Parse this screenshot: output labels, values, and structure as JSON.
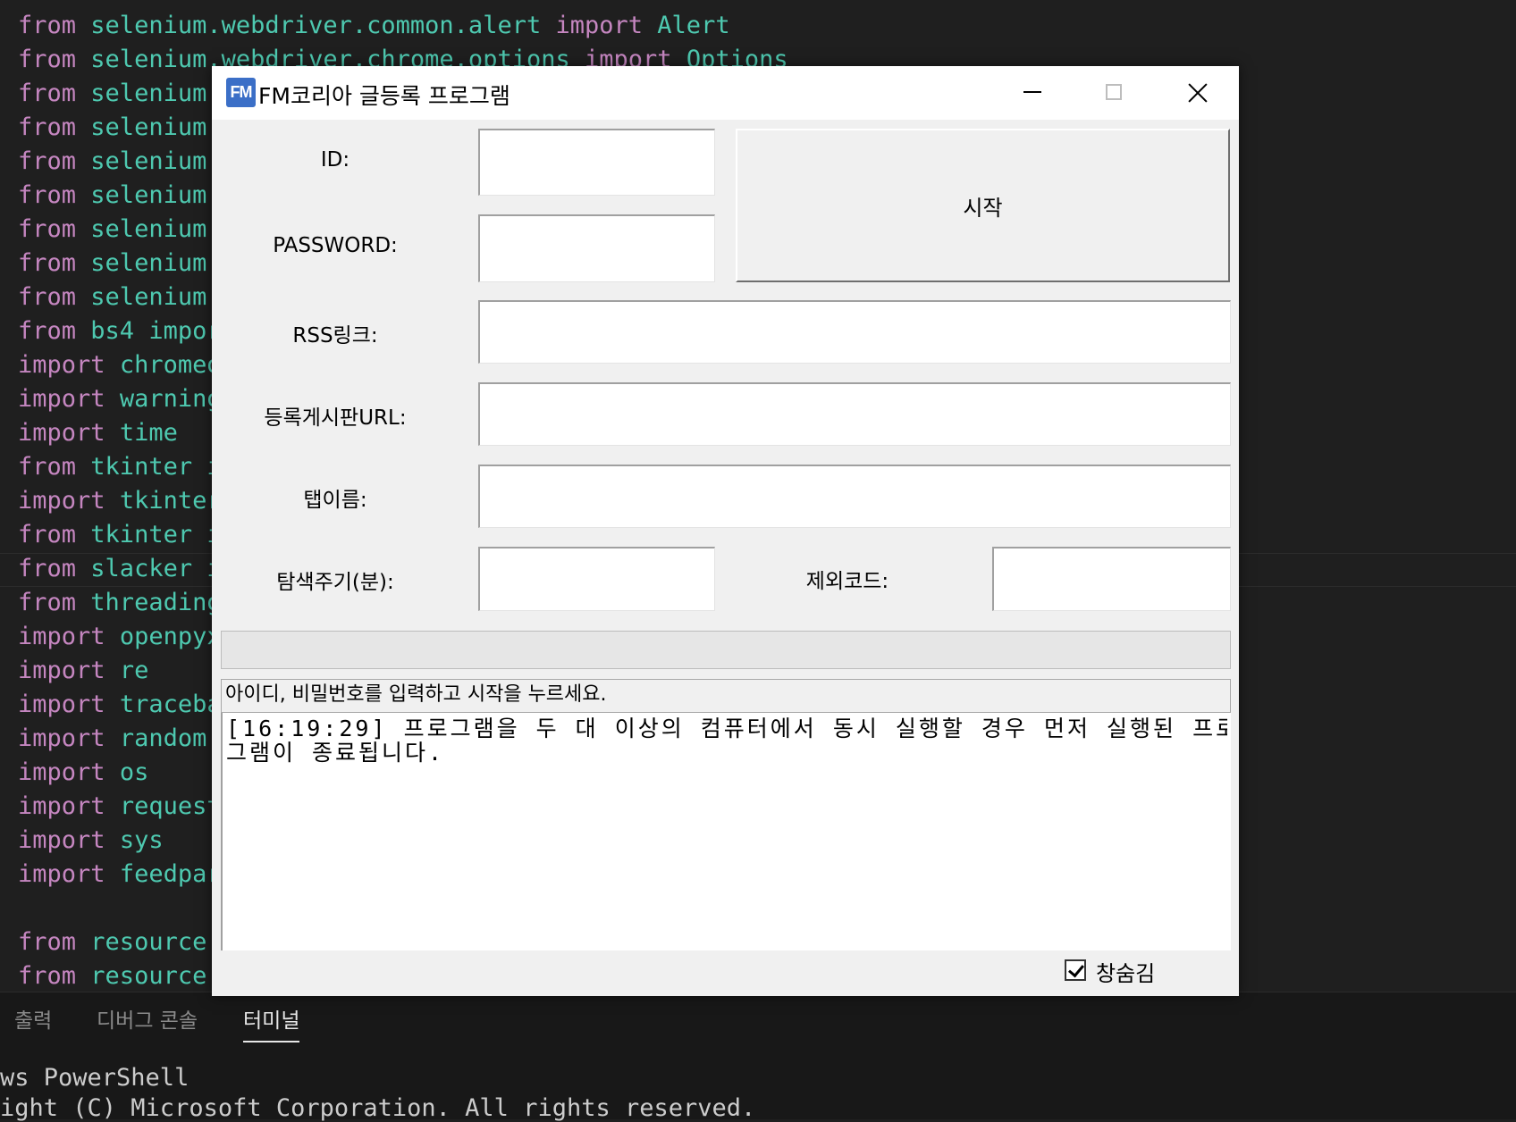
{
  "editor": {
    "lines": [
      {
        "kw": "from",
        "rest": "selenium.webdriver.common.alert",
        "kw2": "import",
        "tail": "Alert"
      },
      {
        "kw": "from",
        "rest": "selenium.webdriver.chrome.options",
        "kw2": "import",
        "tail": "Options"
      },
      {
        "kw": "from",
        "rest": "selenium."
      },
      {
        "kw": "from",
        "rest": "selenium."
      },
      {
        "kw": "from",
        "rest": "selenium."
      },
      {
        "kw": "from",
        "rest": "selenium."
      },
      {
        "kw": "from",
        "rest": "selenium."
      },
      {
        "kw": "from",
        "rest": "selenium."
      },
      {
        "kw": "from",
        "rest": "selenium."
      },
      {
        "kw": "from",
        "rest": "bs4 impor"
      },
      {
        "kw": "import",
        "rest": "chromed"
      },
      {
        "kw": "import",
        "rest": "warning"
      },
      {
        "kw": "import",
        "rest": "time"
      },
      {
        "kw": "from",
        "rest": "tkinter i"
      },
      {
        "kw": "import",
        "rest": "tkinter"
      },
      {
        "kw": "from",
        "rest": "tkinter i"
      },
      {
        "kw": "from",
        "rest": "slacker i"
      },
      {
        "kw": "from",
        "rest": "threading"
      },
      {
        "kw": "import",
        "rest": "openpyx"
      },
      {
        "kw": "import",
        "rest": "re"
      },
      {
        "kw": "import",
        "rest": "traceba"
      },
      {
        "kw": "import",
        "rest": "random"
      },
      {
        "kw": "import",
        "rest": "os"
      },
      {
        "kw": "import",
        "rest": "request"
      },
      {
        "kw": "import",
        "rest": "sys"
      },
      {
        "kw": "import",
        "rest": "feedpar"
      },
      {
        "kw": "",
        "rest": ""
      },
      {
        "kw": "from",
        "rest": "resource"
      },
      {
        "kw": "from",
        "rest": "resource"
      }
    ]
  },
  "panel": {
    "tabs": [
      "출력",
      "디버그 콘솔",
      "터미널"
    ],
    "terminal_lines": [
      "ws PowerShell",
      "ight (C) Microsoft Corporation. All rights reserved."
    ]
  },
  "window": {
    "icon_text": "FM",
    "title": "FM코리아 글등록 프로그램",
    "labels": {
      "id": "ID:",
      "password": "PASSWORD:",
      "rss": "RSS링크:",
      "board_url": "등록게시판URL:",
      "tab_name": "탭이름:",
      "interval": "탐색주기(분):",
      "exclude_code": "제외코드:"
    },
    "values": {
      "id": "",
      "password": "",
      "rss": "",
      "board_url": "",
      "tab_name": "",
      "interval": "",
      "exclude_code": ""
    },
    "start_button": "시작",
    "status": "아이디, 비밀번호를 입력하고 시작을 누르세요.",
    "log_line1": "[16:19:29] 프로그램을 두 대 이상의 컴퓨터에서 동시 실행할 경우 먼저 실행된 프로",
    "log_line2": "그램이 종료됩니다.",
    "hide_window_label": "창숨김",
    "hide_window_checked": true
  },
  "colors": {
    "keyword": "#c586c0",
    "module": "#4ec9b0",
    "app_icon": "#3b6fc7"
  }
}
